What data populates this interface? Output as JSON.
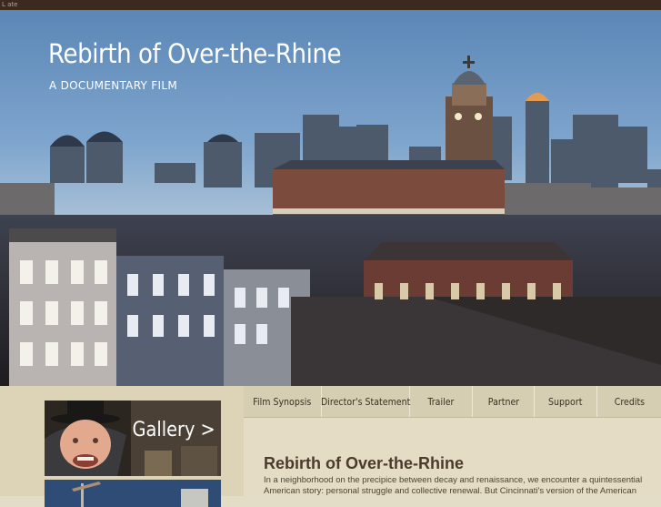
{
  "topbar": {
    "text": "L ate"
  },
  "hero": {
    "title": "Rebirth of Over-the-Rhine",
    "subtitle": "A DOCUMENTARY FILM",
    "image_icon": "city-skyline-image"
  },
  "sidebar": {
    "gallery_label": "Gallery >",
    "gallery_image": "man-in-top-hat-photo",
    "second_image": "neighborhood-photo"
  },
  "nav": {
    "items": [
      {
        "label": "Film Synopsis"
      },
      {
        "label": "Director's Statement"
      },
      {
        "label": "Trailer"
      },
      {
        "label": "Partner"
      },
      {
        "label": "Support"
      },
      {
        "label": "Credits"
      }
    ]
  },
  "content": {
    "title": "Rebirth of Over-the-Rhine",
    "paragraph": "In a neighborhood on the precipice between decay and renaissance, we encounter a quintessential American story: personal struggle and collective renewal. But Cincinnati's version of the American"
  },
  "colors": {
    "page_bg": "#e3dcc6",
    "nav_bg": "#d6ceb3",
    "title_text": "#4a3b2c",
    "topbar": "#3b2a20"
  }
}
